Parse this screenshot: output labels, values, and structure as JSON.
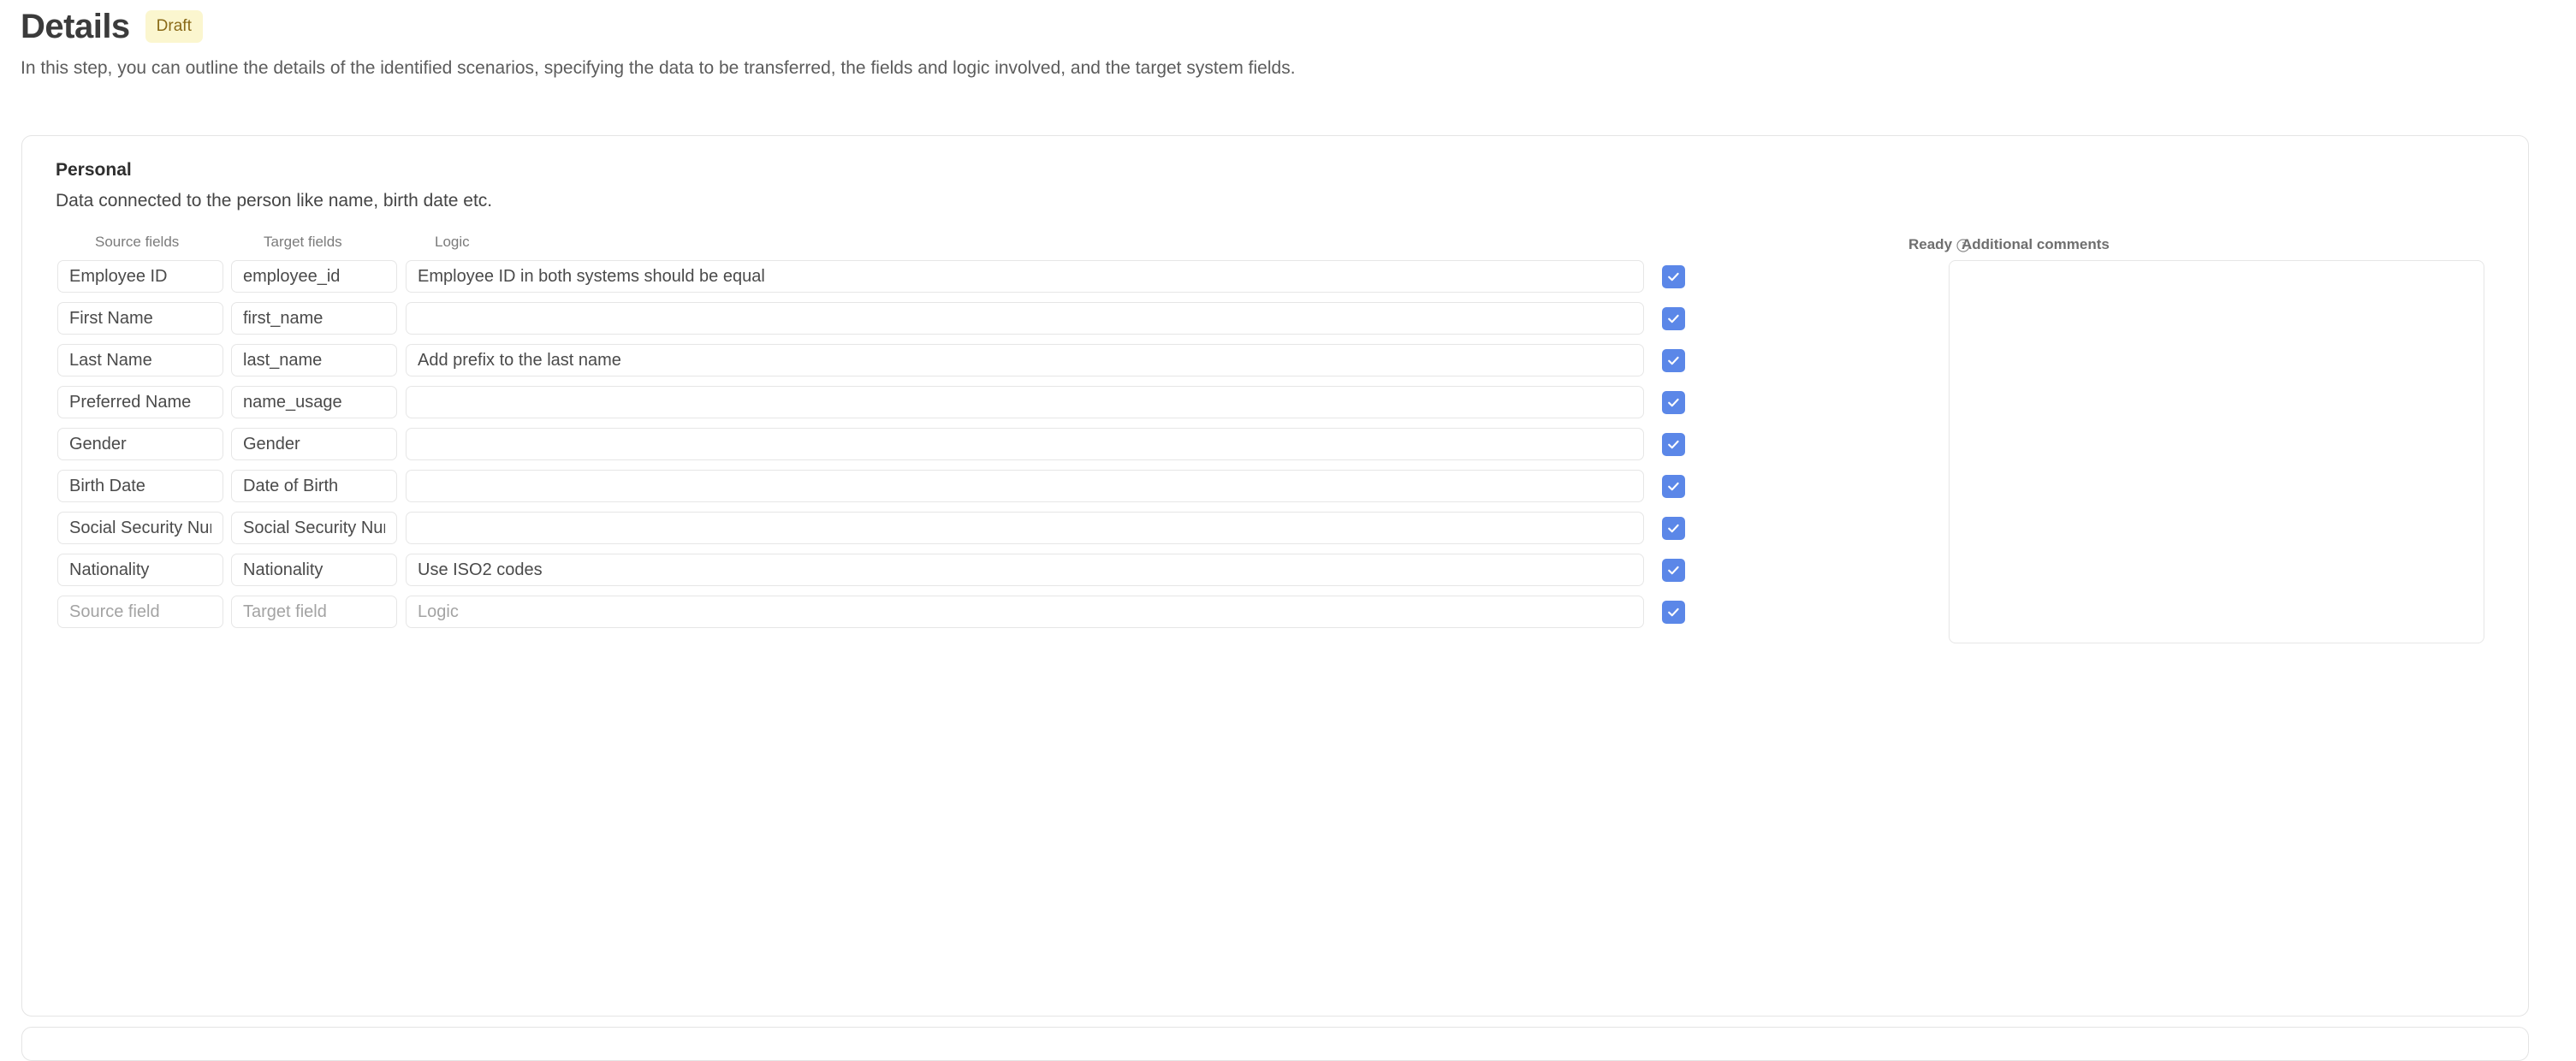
{
  "header": {
    "title": "Details",
    "status_badge": "Draft",
    "subtitle": "In this step, you can outline the details of the identified scenarios, specifying the data to be transferred, the fields and logic involved, and the target system fields."
  },
  "section": {
    "title": "Personal",
    "description": "Data connected to the person like name, birth date etc.",
    "columns": {
      "source": "Source fields",
      "target": "Target fields",
      "logic": "Logic",
      "ready": "Ready",
      "ready_info_icon": "info-icon",
      "comments": "Additional comments"
    },
    "placeholders": {
      "source": "Source field",
      "target": "Target field",
      "logic": "Logic",
      "comments": ""
    },
    "comments_value": "",
    "rows": [
      {
        "source": "Employee ID",
        "target": "employee_id",
        "logic": "Employee ID in both systems should be equal",
        "ready": true
      },
      {
        "source": "First Name",
        "target": "first_name",
        "logic": "",
        "ready": true
      },
      {
        "source": "Last Name",
        "target": "last_name",
        "logic": "Add prefix to the last name",
        "ready": true
      },
      {
        "source": "Preferred Name",
        "target": "name_usage",
        "logic": "",
        "ready": true
      },
      {
        "source": "Gender",
        "target": "Gender",
        "logic": "",
        "ready": true
      },
      {
        "source": "Birth Date",
        "target": "Date of Birth",
        "logic": "",
        "ready": true
      },
      {
        "source": "Social Security Number",
        "target": "Social Security Number",
        "logic": "",
        "ready": true
      },
      {
        "source": "Nationality",
        "target": "Nationality",
        "logic": "Use ISO2 codes",
        "ready": true
      },
      {
        "source": "",
        "target": "",
        "logic": "",
        "ready": true
      }
    ]
  },
  "colors": {
    "checkbox_checked": "#5b87e8",
    "badge_bg": "#fbf6cf",
    "badge_text": "#8a6a17",
    "border": "#e6e6e6"
  }
}
